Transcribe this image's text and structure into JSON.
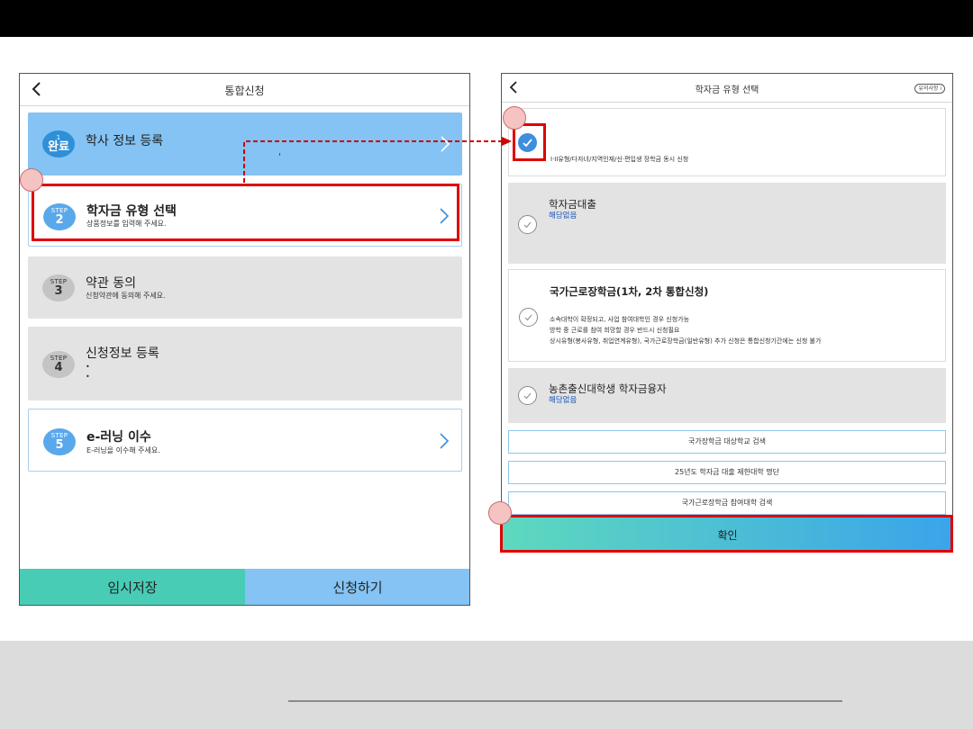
{
  "left_panel": {
    "title": "통합신청",
    "steps": [
      {
        "badge_top": "1",
        "badge_num": "완료",
        "title": "학사 정보 등록"
      },
      {
        "badge_top": "STEP",
        "badge_num": "2",
        "title": "학자금 유형 선택",
        "sub": "상품정보를 입력해 주세요."
      },
      {
        "badge_top": "STEP",
        "badge_num": "3",
        "title": "약관 동의",
        "sub": "신청약관에 동의해 주세요."
      },
      {
        "badge_top": "STEP",
        "badge_num": "4",
        "title": "신청정보 등록",
        "bullets": [
          "•",
          "•"
        ]
      },
      {
        "badge_top": "STEP",
        "badge_num": "5",
        "title": "e-러닝 이수",
        "sub": "E-러닝을 이수해 주세요."
      }
    ],
    "buttons": {
      "temp_save": "임시저장",
      "apply": "신청하기"
    }
  },
  "right_panel": {
    "title": "학자금 유형 선택",
    "notice": "유의사항 i",
    "options": [
      {
        "line": "I·II유형/다자녀/지역인재/신·편입생 장학금 동시 신청",
        "checked": true
      },
      {
        "title": "학자금대출",
        "sub": "해당없음",
        "checked": false
      },
      {
        "title": "국가근로장학금(1차, 2차 통합신청)",
        "lines": [
          "소속대학이 확정되고, 사업 참여대학인 경우 신청가능",
          "방학 중 근로를 참여 희망할 경우 반드시 신청필요",
          "상시유형(봉사유형, 취업연계유형), 국가근로장학금(일반유형) 추가 신청은 통합신청기간에는 신청 불가"
        ],
        "checked": false
      },
      {
        "title": "농촌출신대학생 학자금융자",
        "sub": "해당없음",
        "checked": false
      }
    ],
    "links": [
      "국가장학금 대상학교 검색",
      "25년도 학자금 대출 제한대학 명단",
      "국가근로장학금 참여대학 검색"
    ],
    "confirm": "확인"
  },
  "colors": {
    "highlight": "#e00000",
    "marker": "#f6c3c3",
    "completed_bg": "#84c3f3",
    "temp_save_bg": "#48ccb6",
    "apply_bg": "#84c3f3",
    "check_on": "#3d8fde",
    "confirm_gradient": [
      "#5ed9be",
      "#3aa4ea"
    ]
  }
}
